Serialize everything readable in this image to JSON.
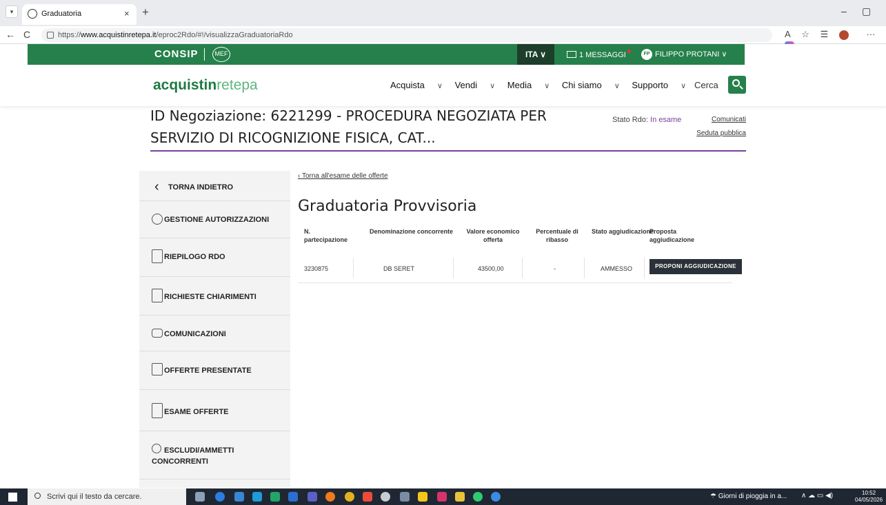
{
  "browser": {
    "tab_title": "Graduatoria",
    "tab_close": "×",
    "new_tab": "+",
    "url_prefix": "https://",
    "url_domain": "www.acquistinretepa.it",
    "url_path": "/eproc2Rdo/#!/visualizzaGraduatoriaRdo",
    "minimize": "–",
    "restore": "▢",
    "back": "←",
    "reload": "C",
    "more": "···"
  },
  "topbar": {
    "brand": "CONSIP",
    "mef": "MEF",
    "language": "ITA",
    "messages": "1 MESSAGGI",
    "user_initials": "FP",
    "user_name": "FILIPPO PROTANI"
  },
  "header": {
    "logo_main": "acquistin",
    "logo_light1": "rete",
    "logo_light2": "pa",
    "nav": [
      "Acquista",
      "Vendi",
      "Media",
      "Chi siamo",
      "Supporto"
    ],
    "search_label": "Cerca"
  },
  "page": {
    "title_line1": "ID Negoziazione: 6221299 - PROCEDURA NEGOZIATA PER",
    "title_line2": "SERVIZIO DI RICOGNIZIONE FISICA, CAT...",
    "stato_label": "Stato Rdo:",
    "stato_value": "In esame",
    "link_comunicati": "Comunicati",
    "link_seduta": "Seduta pubblica",
    "colors": {
      "accent": "#7b3f9e",
      "brand": "#26804b"
    }
  },
  "sidebar": {
    "back": "TORNA INDIETRO",
    "items": [
      {
        "label": "GESTIONE AUTORIZZAZIONI",
        "icon": "key-icon"
      },
      {
        "label": "RIEPILOGO RDO",
        "icon": "clipboard-icon"
      },
      {
        "label": "RICHIESTE CHIARIMENTI",
        "icon": "document-question-icon"
      },
      {
        "label": "COMUNICAZIONI",
        "icon": "chat-icon"
      },
      {
        "label": "OFFERTE PRESENTATE",
        "icon": "offer-icon"
      },
      {
        "label": "ESAME OFFERTE",
        "icon": "document-review-icon"
      },
      {
        "label": "ESCLUDI/AMMETTI",
        "label2": "CONCORRENTI",
        "icon": "user-settings-icon"
      }
    ]
  },
  "main": {
    "back_link": "Torna all'esame delle offerte",
    "heading": "Graduatoria Provvisoria",
    "columns": [
      {
        "l1": "N.",
        "l2": "partecipazione"
      },
      {
        "l1": "Denominazione concorrente",
        "l2": ""
      },
      {
        "l1": "Valore economico",
        "l2": "offerta"
      },
      {
        "l1": "Percentuale di",
        "l2": "ribasso"
      },
      {
        "l1": "Stato aggiudicazione",
        "l2": ""
      },
      {
        "l1": "Proposta",
        "l2": "aggiudicazione"
      }
    ],
    "rows": [
      {
        "n": "3230875",
        "denominazione": "DB SERET",
        "valore": "43500,00",
        "ribasso": "-",
        "stato": "AMMESSO",
        "azione": "PROPONI AGGIUDICAZIONE"
      }
    ]
  },
  "taskbar": {
    "search_placeholder": "Scrivi qui il testo da cercare.",
    "weather": "Giorni di pioggia in a...",
    "time": "10:52",
    "date": "04/05/2026"
  }
}
